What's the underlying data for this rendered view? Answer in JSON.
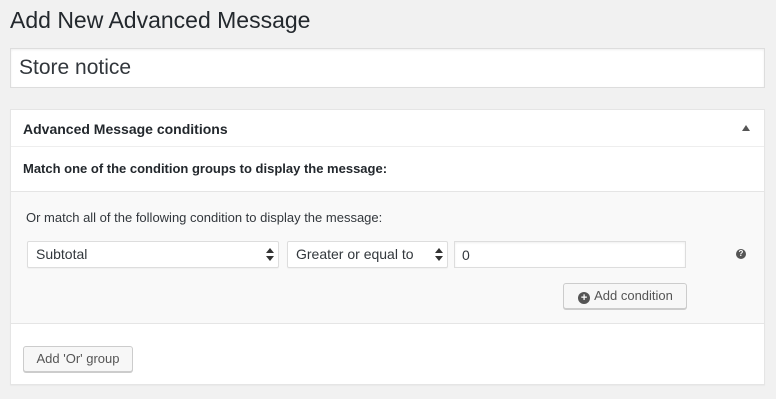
{
  "page": {
    "title": "Add New Advanced Message"
  },
  "post_title": {
    "value": "Store notice"
  },
  "metabox": {
    "title": "Advanced Message conditions",
    "match_description": "Match one of the condition groups to display the message:",
    "group": {
      "description": "Or match all of the following condition to display the message:",
      "condition": {
        "field": "Subtotal",
        "operator": "Greater or equal to",
        "value": "0"
      },
      "help_glyph": "?",
      "add_condition_label": "Add condition",
      "add_condition_icon": "plus-circle-icon"
    },
    "add_or_group_label": "Add 'Or' group"
  },
  "colors": {
    "background": "#f1f1f1",
    "panel": "#ffffff",
    "group_background": "#f9f9f9",
    "text": "#23282d",
    "button_bg": "#f7f7f7"
  }
}
